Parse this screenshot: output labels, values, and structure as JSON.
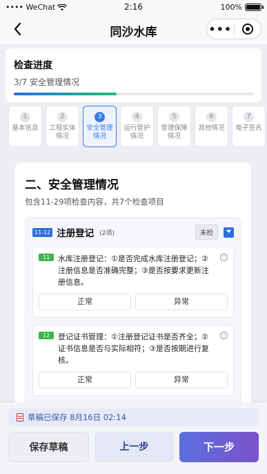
{
  "status_bar": {
    "carrier": "•••• WeChat",
    "time": "2:16",
    "battery": "100%"
  },
  "nav": {
    "title": "同沙水库",
    "more": "•••"
  },
  "progress": {
    "title": "检查进度",
    "subtitle": "3/7 安全管理情况",
    "fraction": 0.43
  },
  "steps": [
    {
      "num": "1",
      "label": "基本信息"
    },
    {
      "num": "2",
      "label": "工程实体情况"
    },
    {
      "num": "3",
      "label": "安全管理情况"
    },
    {
      "num": "4",
      "label": "运行管护情况"
    },
    {
      "num": "5",
      "label": "管理保障情况"
    },
    {
      "num": "6",
      "label": "其他情况"
    },
    {
      "num": "7",
      "label": "电子签名"
    }
  ],
  "section": {
    "title": "二、安全管理情况",
    "subtitle": "包含11-29项检查内容，共7个检查项目"
  },
  "group": {
    "range": "11-12",
    "name": "注册登记",
    "count": "(2项)",
    "status": "未检"
  },
  "items": [
    {
      "tag": "11",
      "text": "水库注册登记：①是否完成水库注册登记；②注册信息是否准确完整；③是否按要求更新注册信息。",
      "normal": "正常",
      "abnormal": "异常"
    },
    {
      "tag": "12",
      "text": "登记证书管理：①注册登记证书是否齐全；②证书信息是否与实际相符；③是否按期进行复核。",
      "normal": "正常",
      "abnormal": "异常"
    }
  ],
  "draft": {
    "text": "草稿已保存 8月16日 02:14"
  },
  "buttons": {
    "save": "保存草稿",
    "prev": "上一步",
    "next": "下一步"
  },
  "colors": {
    "accent": "#3a7be8",
    "tag_green": "#3cb54a",
    "next_gradient_start": "#5b6fde",
    "next_gradient_end": "#7a53c9"
  }
}
